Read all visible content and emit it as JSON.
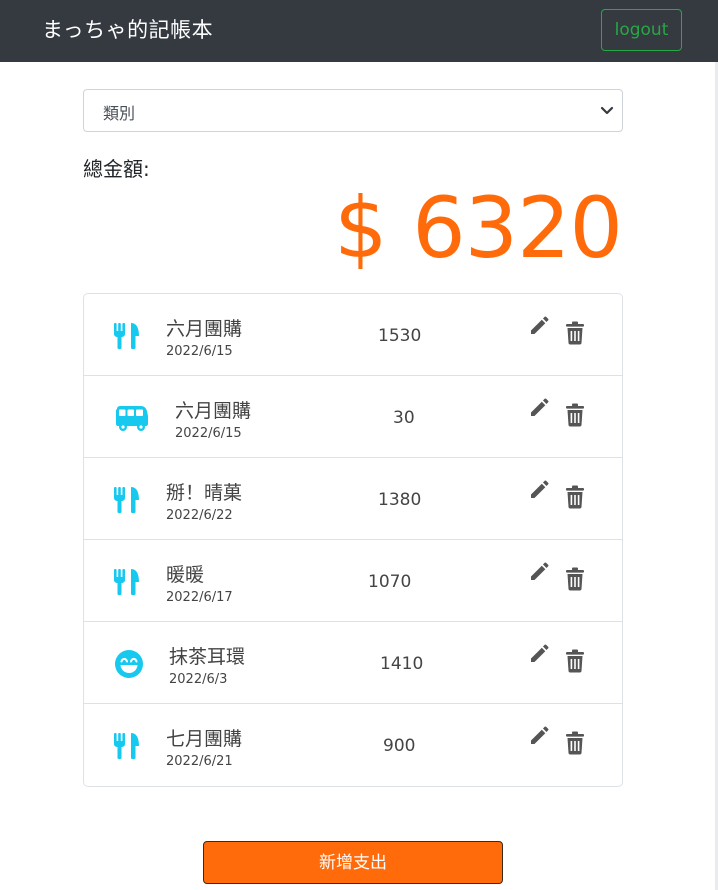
{
  "header": {
    "brand": "まっちゃ的記帳本",
    "logout_label": "logout"
  },
  "filter": {
    "selected": "類別"
  },
  "total": {
    "label": "總金額:",
    "amount": "$ 6320"
  },
  "records": [
    {
      "category_icon": "utensils-icon",
      "name": "六月團購",
      "date": "2022/6/15",
      "amount": "1530"
    },
    {
      "category_icon": "bus-icon",
      "name": "六月團購",
      "date": "2022/6/15",
      "amount": "30"
    },
    {
      "category_icon": "utensils-icon",
      "name": "掰！晴菓",
      "date": "2022/6/22",
      "amount": "1380"
    },
    {
      "category_icon": "utensils-icon",
      "name": "暖暖",
      "date": "2022/6/17",
      "amount": "1070"
    },
    {
      "category_icon": "smile-icon",
      "name": "抹茶耳環",
      "date": "2022/6/3",
      "amount": "1410"
    },
    {
      "category_icon": "utensils-icon",
      "name": "七月團購",
      "date": "2022/6/21",
      "amount": "900"
    }
  ],
  "add_button_label": "新增支出",
  "colors": {
    "navbar": "#343a40",
    "accent": "#ff6b0a",
    "icon": "#17c9ee",
    "logout": "#28a745",
    "action_icon": "#555555"
  }
}
